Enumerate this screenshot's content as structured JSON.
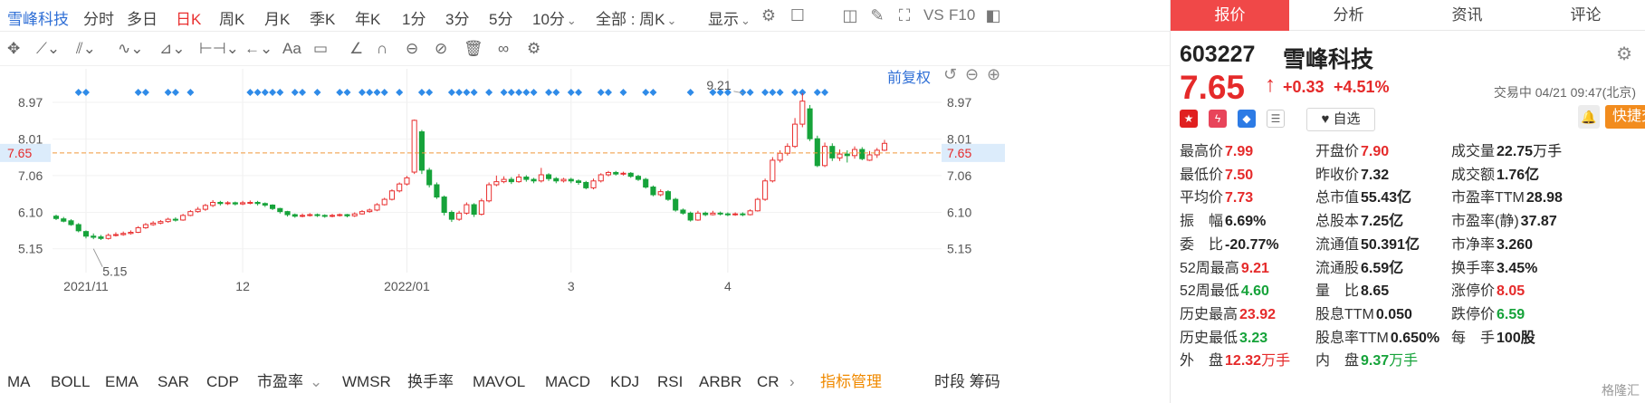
{
  "toolbar": {
    "stock_name": "雪峰科技",
    "periods": [
      "分时",
      "多日",
      "日K",
      "周K",
      "月K",
      "季K",
      "年K",
      "1分",
      "3分",
      "5分",
      "10分"
    ],
    "active_period": "日K",
    "range_select": "全部 : 周K",
    "display_label": "显示",
    "vs_label": "VS",
    "f10_label": "F10"
  },
  "chart_header": {
    "adjust_label": "前复权"
  },
  "chart_data": {
    "type": "candlestick",
    "ylim": [
      4.6,
      9.3
    ],
    "yticks": [
      8.97,
      8.01,
      7.06,
      6.1,
      5.15
    ],
    "current_price": 7.65,
    "xtick_labels": [
      {
        "label": "2021/11",
        "index": 4
      },
      {
        "label": "12",
        "index": 25
      },
      {
        "label": "2022/01",
        "index": 47
      },
      {
        "label": "3",
        "index": 69
      },
      {
        "label": "4",
        "index": 90
      }
    ],
    "annotations": [
      {
        "label": "9.21",
        "index": 92,
        "value": 9.21
      },
      {
        "label": "5.15",
        "index": 5,
        "value": 5.15
      }
    ],
    "marker_indices": [
      3,
      4,
      11,
      12,
      15,
      16,
      18,
      26,
      27,
      28,
      29,
      30,
      32,
      33,
      35,
      38,
      39,
      41,
      42,
      43,
      44,
      46,
      49,
      50,
      53,
      54,
      55,
      56,
      58,
      60,
      61,
      62,
      63,
      64,
      66,
      67,
      69,
      70,
      73,
      74,
      76,
      79,
      80,
      85,
      88,
      89,
      90,
      92,
      93,
      95,
      96,
      97,
      99,
      100,
      102,
      103
    ],
    "candles": [
      [
        6.0,
        5.94,
        6.04,
        5.9
      ],
      [
        5.93,
        5.87,
        5.98,
        5.84
      ],
      [
        5.88,
        5.78,
        5.92,
        5.75
      ],
      [
        5.78,
        5.62,
        5.82,
        5.58
      ],
      [
        5.6,
        5.48,
        5.63,
        5.42
      ],
      [
        5.48,
        5.45,
        5.55,
        5.4
      ],
      [
        5.46,
        5.42,
        5.51,
        5.38
      ],
      [
        5.42,
        5.5,
        5.55,
        5.39
      ],
      [
        5.5,
        5.52,
        5.58,
        5.47
      ],
      [
        5.52,
        5.55,
        5.6,
        5.49
      ],
      [
        5.55,
        5.58,
        5.63,
        5.52
      ],
      [
        5.58,
        5.7,
        5.74,
        5.56
      ],
      [
        5.7,
        5.78,
        5.82,
        5.67
      ],
      [
        5.78,
        5.82,
        5.87,
        5.75
      ],
      [
        5.82,
        5.86,
        5.9,
        5.79
      ],
      [
        5.86,
        5.92,
        5.96,
        5.83
      ],
      [
        5.92,
        5.9,
        5.97,
        5.86
      ],
      [
        5.9,
        6.02,
        6.06,
        5.88
      ],
      [
        6.02,
        6.12,
        6.16,
        6.0
      ],
      [
        6.12,
        6.18,
        6.24,
        6.09
      ],
      [
        6.18,
        6.28,
        6.32,
        6.14
      ],
      [
        6.28,
        6.36,
        6.42,
        6.24
      ],
      [
        6.36,
        6.33,
        6.4,
        6.28
      ],
      [
        6.33,
        6.35,
        6.39,
        6.29
      ],
      [
        6.35,
        6.32,
        6.38,
        6.28
      ],
      [
        6.32,
        6.35,
        6.4,
        6.29
      ],
      [
        6.35,
        6.36,
        6.41,
        6.31
      ],
      [
        6.36,
        6.33,
        6.4,
        6.28
      ],
      [
        6.33,
        6.29,
        6.36,
        6.24
      ],
      [
        6.29,
        6.2,
        6.31,
        6.16
      ],
      [
        6.2,
        6.12,
        6.22,
        6.07
      ],
      [
        6.12,
        6.04,
        6.14,
        5.99
      ],
      [
        6.04,
        6.0,
        6.07,
        5.96
      ],
      [
        6.0,
        6.02,
        6.07,
        5.97
      ],
      [
        6.02,
        6.04,
        6.08,
        5.99
      ],
      [
        6.04,
        6.02,
        6.07,
        5.98
      ],
      [
        6.02,
        6.0,
        6.05,
        5.96
      ],
      [
        6.0,
        6.02,
        6.06,
        5.97
      ],
      [
        6.02,
        6.04,
        6.07,
        5.99
      ],
      [
        6.04,
        6.01,
        6.06,
        5.97
      ],
      [
        6.01,
        6.06,
        6.1,
        5.98
      ],
      [
        6.06,
        6.12,
        6.16,
        6.04
      ],
      [
        6.12,
        6.16,
        6.2,
        6.09
      ],
      [
        6.16,
        6.3,
        6.34,
        6.13
      ],
      [
        6.3,
        6.44,
        6.48,
        6.28
      ],
      [
        6.44,
        6.66,
        6.7,
        6.41
      ],
      [
        6.66,
        6.84,
        6.88,
        6.62
      ],
      [
        6.84,
        7.0,
        7.05,
        6.8
      ],
      [
        7.15,
        8.5,
        8.52,
        7.1
      ],
      [
        8.2,
        7.2,
        8.25,
        7.1
      ],
      [
        7.2,
        6.82,
        7.26,
        6.75
      ],
      [
        6.82,
        6.5,
        6.88,
        6.45
      ],
      [
        6.5,
        6.1,
        6.54,
        6.02
      ],
      [
        6.1,
        5.92,
        6.15,
        5.85
      ],
      [
        5.92,
        6.08,
        6.14,
        5.88
      ],
      [
        6.08,
        6.3,
        6.36,
        6.04
      ],
      [
        6.3,
        6.05,
        6.34,
        5.98
      ],
      [
        6.05,
        6.4,
        6.46,
        6.02
      ],
      [
        6.4,
        6.82,
        6.88,
        6.36
      ],
      [
        6.82,
        6.9,
        7.06,
        6.78
      ],
      [
        6.9,
        6.96,
        7.04,
        6.86
      ],
      [
        6.96,
        6.9,
        7.02,
        6.84
      ],
      [
        6.9,
        7.02,
        7.1,
        6.87
      ],
      [
        7.02,
        6.96,
        7.07,
        6.9
      ],
      [
        6.96,
        6.92,
        7.0,
        6.86
      ],
      [
        6.92,
        7.08,
        7.26,
        6.88
      ],
      [
        7.08,
        6.98,
        7.12,
        6.92
      ],
      [
        6.98,
        6.92,
        7.02,
        6.86
      ],
      [
        6.92,
        6.96,
        7.0,
        6.88
      ],
      [
        6.96,
        6.92,
        7.0,
        6.86
      ],
      [
        6.92,
        6.88,
        6.96,
        6.82
      ],
      [
        6.88,
        6.74,
        6.92,
        6.7
      ],
      [
        6.74,
        6.92,
        6.98,
        6.7
      ],
      [
        6.92,
        7.08,
        7.12,
        6.88
      ],
      [
        7.08,
        7.14,
        7.18,
        7.04
      ],
      [
        7.14,
        7.1,
        7.18,
        7.06
      ],
      [
        7.1,
        7.12,
        7.16,
        7.06
      ],
      [
        7.12,
        7.04,
        7.15,
        7.0
      ],
      [
        7.04,
        6.96,
        7.08,
        6.92
      ],
      [
        6.96,
        6.76,
        7.0,
        6.72
      ],
      [
        6.76,
        6.56,
        6.8,
        6.52
      ],
      [
        6.56,
        6.64,
        6.7,
        6.52
      ],
      [
        6.64,
        6.44,
        6.68,
        6.4
      ],
      [
        6.44,
        6.16,
        6.48,
        6.12
      ],
      [
        6.16,
        6.08,
        6.2,
        6.04
      ],
      [
        6.08,
        5.9,
        6.12,
        5.86
      ],
      [
        5.9,
        6.08,
        6.14,
        5.88
      ],
      [
        6.08,
        6.04,
        6.12,
        6.0
      ],
      [
        6.04,
        6.08,
        6.14,
        6.02
      ],
      [
        6.08,
        6.06,
        6.12,
        6.02
      ],
      [
        6.06,
        6.04,
        6.1,
        6.0
      ],
      [
        6.04,
        6.06,
        6.1,
        6.01
      ],
      [
        6.06,
        6.04,
        6.1,
        6.0
      ],
      [
        6.04,
        6.14,
        6.18,
        6.02
      ],
      [
        6.14,
        6.44,
        6.48,
        6.12
      ],
      [
        6.44,
        6.92,
        6.98,
        6.4
      ],
      [
        6.92,
        7.46,
        7.54,
        6.88
      ],
      [
        7.46,
        7.64,
        7.72,
        7.4
      ],
      [
        7.64,
        7.82,
        7.9,
        7.58
      ],
      [
        7.82,
        8.4,
        8.56,
        7.78
      ],
      [
        8.4,
        9.0,
        9.21,
        8.32
      ],
      [
        8.8,
        8.02,
        8.9,
        7.96
      ],
      [
        8.02,
        7.32,
        8.1,
        7.28
      ],
      [
        7.32,
        7.82,
        7.92,
        7.28
      ],
      [
        7.82,
        7.52,
        7.9,
        7.44
      ],
      [
        7.52,
        7.62,
        7.74,
        7.44
      ],
      [
        7.62,
        7.58,
        7.72,
        7.4
      ],
      [
        7.58,
        7.74,
        7.82,
        7.5
      ],
      [
        7.74,
        7.5,
        7.8,
        7.46
      ],
      [
        7.46,
        7.6,
        7.7,
        7.44
      ],
      [
        7.6,
        7.72,
        7.78,
        7.52
      ],
      [
        7.72,
        7.9,
        7.99,
        7.7
      ]
    ]
  },
  "indicators": [
    "MA",
    "BOLL",
    "EMA",
    "SAR",
    "CDP",
    "市盈率",
    "WMSR",
    "换手率",
    "MAVOL",
    "MACD",
    "KDJ",
    "RSI",
    "ARBR",
    "CR"
  ],
  "indicator_manage": "指标管理",
  "indicator_right": "时段 筹码",
  "panel": {
    "tabs": [
      "报价",
      "分析",
      "资讯",
      "评论"
    ],
    "code": "603227",
    "name": "雪峰科技",
    "price": "7.65",
    "price_arrow": "↑",
    "change": "+0.33",
    "change_pct": "+4.51%",
    "status": "交易中 04/21 09:47(北京)",
    "zixuan_label": "自选",
    "quick_trade": "快捷交易",
    "quotes": [
      [
        {
          "label": "最高价",
          "value": "7.99",
          "color": "red"
        },
        {
          "label": "开盘价",
          "value": "7.90",
          "color": "red"
        },
        {
          "label": "成交量",
          "value": "22.75",
          "unit": "万手",
          "color": "blk"
        }
      ],
      [
        {
          "label": "最低价",
          "value": "7.50",
          "color": "red"
        },
        {
          "label": "昨收价",
          "value": "7.32",
          "color": "blk"
        },
        {
          "label": "成交额",
          "value": "1.76亿",
          "color": "blk"
        }
      ],
      [
        {
          "label": "平均价",
          "value": "7.73",
          "color": "red"
        },
        {
          "label": "总市值",
          "value": "55.43亿",
          "color": "blk"
        },
        {
          "label": "市盈率TTM",
          "value": "28.98",
          "color": "blk"
        }
      ],
      [
        {
          "label": "振　幅",
          "value": "6.69%",
          "color": "blk"
        },
        {
          "label": "总股本",
          "value": "7.25亿",
          "color": "blk"
        },
        {
          "label": "市盈率(静)",
          "value": "37.87",
          "color": "blk"
        }
      ],
      [
        {
          "label": "委　比",
          "value": "-20.77%",
          "color": "blk"
        },
        {
          "label": "流通值",
          "value": "50.391亿",
          "color": "blk"
        },
        {
          "label": "市净率",
          "value": "3.260",
          "color": "blk"
        }
      ],
      [
        {
          "label": "52周最高",
          "value": "9.21",
          "color": "red"
        },
        {
          "label": "流通股",
          "value": "6.59亿",
          "color": "blk"
        },
        {
          "label": "换手率",
          "value": "3.45%",
          "color": "blk"
        }
      ],
      [
        {
          "label": "52周最低",
          "value": "4.60",
          "color": "green"
        },
        {
          "label": "量　比",
          "value": "8.65",
          "color": "blk"
        },
        {
          "label": "涨停价",
          "value": "8.05",
          "color": "red"
        }
      ],
      [
        {
          "label": "历史最高",
          "value": "23.92",
          "color": "red"
        },
        {
          "label": "股息TTM",
          "value": "0.050",
          "color": "blk"
        },
        {
          "label": "跌停价",
          "value": "6.59",
          "color": "green"
        }
      ],
      [
        {
          "label": "历史最低",
          "value": "3.23",
          "color": "green"
        },
        {
          "label": "股息率TTM",
          "value": "0.650%",
          "color": "blk"
        },
        {
          "label": "每　手",
          "value": "100股",
          "color": "blk"
        }
      ],
      [
        {
          "label": "外　盘",
          "value": "12.32",
          "unit": "万手",
          "color": "red"
        },
        {
          "label": "内　盘",
          "value": "9.37",
          "unit": "万手",
          "color": "green"
        },
        {
          "label": "",
          "value": "",
          "color": "blk"
        }
      ]
    ],
    "watermark": "格隆汇"
  }
}
